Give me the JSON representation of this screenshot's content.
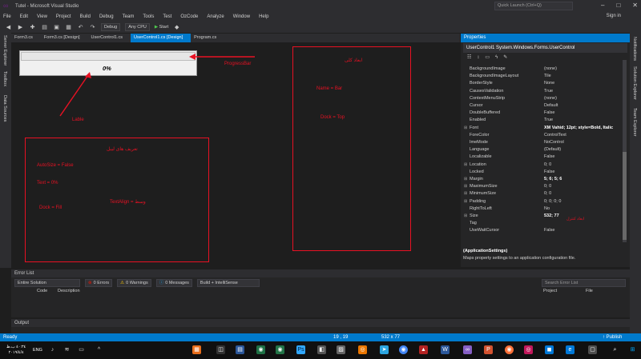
{
  "window": {
    "title": "Tutel - Microsoft Visual Studio",
    "quick_launch_placeholder": "Quick Launch (Ctrl+Q)",
    "sign_in": "Sign in"
  },
  "menu": [
    "File",
    "Edit",
    "View",
    "Project",
    "Build",
    "Debug",
    "Team",
    "Tools",
    "Test",
    "OzCode",
    "Analyze",
    "Window",
    "Help"
  ],
  "toolbar": {
    "config": "Debug",
    "platform": "Any CPU",
    "start": "Start"
  },
  "left_sidebar": [
    "Server Explorer",
    "Toolbox",
    "Data Sources"
  ],
  "right_sidebar": [
    "Notifications",
    "Solution Explorer",
    "Team Explorer"
  ],
  "doc_tabs": [
    {
      "label": "Form3.cs"
    },
    {
      "label": "Form3.cs [Design]"
    },
    {
      "label": "UserControl1.cs"
    },
    {
      "label": "UserControl1.cs [Design]"
    },
    {
      "label": "Program.cs"
    }
  ],
  "designer": {
    "label_text": "0%",
    "ann_progressbar": "ProgressBar",
    "ann_lable": "Lable",
    "box_right_title": "ابعاد کلی",
    "box_right_name": "Name = Bar",
    "box_right_dock": "Dock = Top",
    "box_left_title": "تعریف های لیبل",
    "box_left_autosize": "AutoSize = False",
    "box_left_text": "Text = 0%",
    "box_left_textalign": "TextAlign = وسط",
    "box_left_dock": "Dock = Fill"
  },
  "properties": {
    "header": "Properties",
    "object": "UserControl1  System.Windows.Forms.UserControl",
    "size_note": "ابعاد کنترل",
    "rows": [
      {
        "name": "BackgroundImage",
        "value": "(none)",
        "expand": ""
      },
      {
        "name": "BackgroundImageLayout",
        "value": "Tile",
        "expand": ""
      },
      {
        "name": "BorderStyle",
        "value": "None",
        "expand": ""
      },
      {
        "name": "CausesValidation",
        "value": "True",
        "expand": ""
      },
      {
        "name": "ContextMenuStrip",
        "value": "(none)",
        "expand": ""
      },
      {
        "name": "Cursor",
        "value": "Default",
        "expand": ""
      },
      {
        "name": "DoubleBuffered",
        "value": "False",
        "expand": ""
      },
      {
        "name": "Enabled",
        "value": "True",
        "expand": ""
      },
      {
        "name": "Font",
        "value": "XM Vahid; 12pt; style=Bold, Italic",
        "expand": "⊞"
      },
      {
        "name": "ForeColor",
        "value": "ControlText",
        "expand": ""
      },
      {
        "name": "ImeMode",
        "value": "NoControl",
        "expand": ""
      },
      {
        "name": "Language",
        "value": "(Default)",
        "expand": ""
      },
      {
        "name": "Localizable",
        "value": "False",
        "expand": ""
      },
      {
        "name": "Location",
        "value": "0; 0",
        "expand": "⊞"
      },
      {
        "name": "Locked",
        "value": "False",
        "expand": ""
      },
      {
        "name": "Margin",
        "value": "5; 6; 5; 6",
        "expand": "⊞"
      },
      {
        "name": "MaximumSize",
        "value": "0; 0",
        "expand": "⊞"
      },
      {
        "name": "MinimumSize",
        "value": "0; 0",
        "expand": "⊞"
      },
      {
        "name": "Padding",
        "value": "0; 0; 0; 0",
        "expand": "⊞"
      },
      {
        "name": "RightToLeft",
        "value": "No",
        "expand": ""
      },
      {
        "name": "Size",
        "value": "532; 77",
        "expand": "⊞"
      },
      {
        "name": "Tag",
        "value": "",
        "expand": ""
      },
      {
        "name": "UseWaitCursor",
        "value": "False",
        "expand": ""
      }
    ],
    "desc_title": "(ApplicationSettings)",
    "desc_text": "Maps property settings to an application configuration file."
  },
  "error_list": {
    "header": "Error List",
    "scope": "Entire Solution",
    "errors": "0 Errors",
    "warnings": "0 Warnings",
    "messages": "0 Messages",
    "build": "Build + IntelliSense",
    "search": "Search Error List",
    "col_code": "Code",
    "col_desc": "Description",
    "col_project": "Project",
    "col_file": "File"
  },
  "output": {
    "header": "Output"
  },
  "status": {
    "ready": "Ready",
    "position": "19 , 19",
    "size": "532 x 77",
    "publish": "Publish"
  },
  "taskbar": {
    "time": "٤٠:٣٤ ب.ظ",
    "date": "٢٠١٩/٤/٨",
    "lang": "ENG"
  },
  "colors": {
    "accent": "#007acc",
    "annotation": "#e81123",
    "background": "#1e1e1e"
  }
}
